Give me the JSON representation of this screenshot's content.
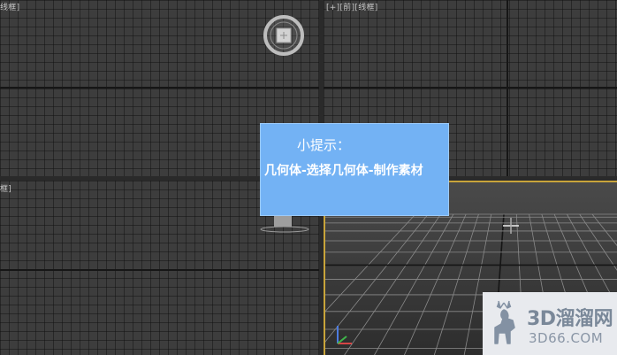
{
  "viewports": {
    "front": {
      "label": "[+][前][线框]"
    },
    "left": {
      "label": "框]"
    }
  },
  "tip": {
    "title": "小提示：",
    "body": "几何体-选择几何体-制作素材"
  },
  "watermark": {
    "title": "3D溜溜网",
    "url": "3D66.COM"
  },
  "icons": {
    "view_cube": "view-cube-icon",
    "axis_tripod": "axis-tripod-icon",
    "cursor": "crosshair-cursor-icon",
    "logo": "deer-logo-icon"
  },
  "colors": {
    "tip_background": "#73b2f4",
    "active_viewport_border": "#c8a43a",
    "viewport_background": "#3d3d3d"
  }
}
